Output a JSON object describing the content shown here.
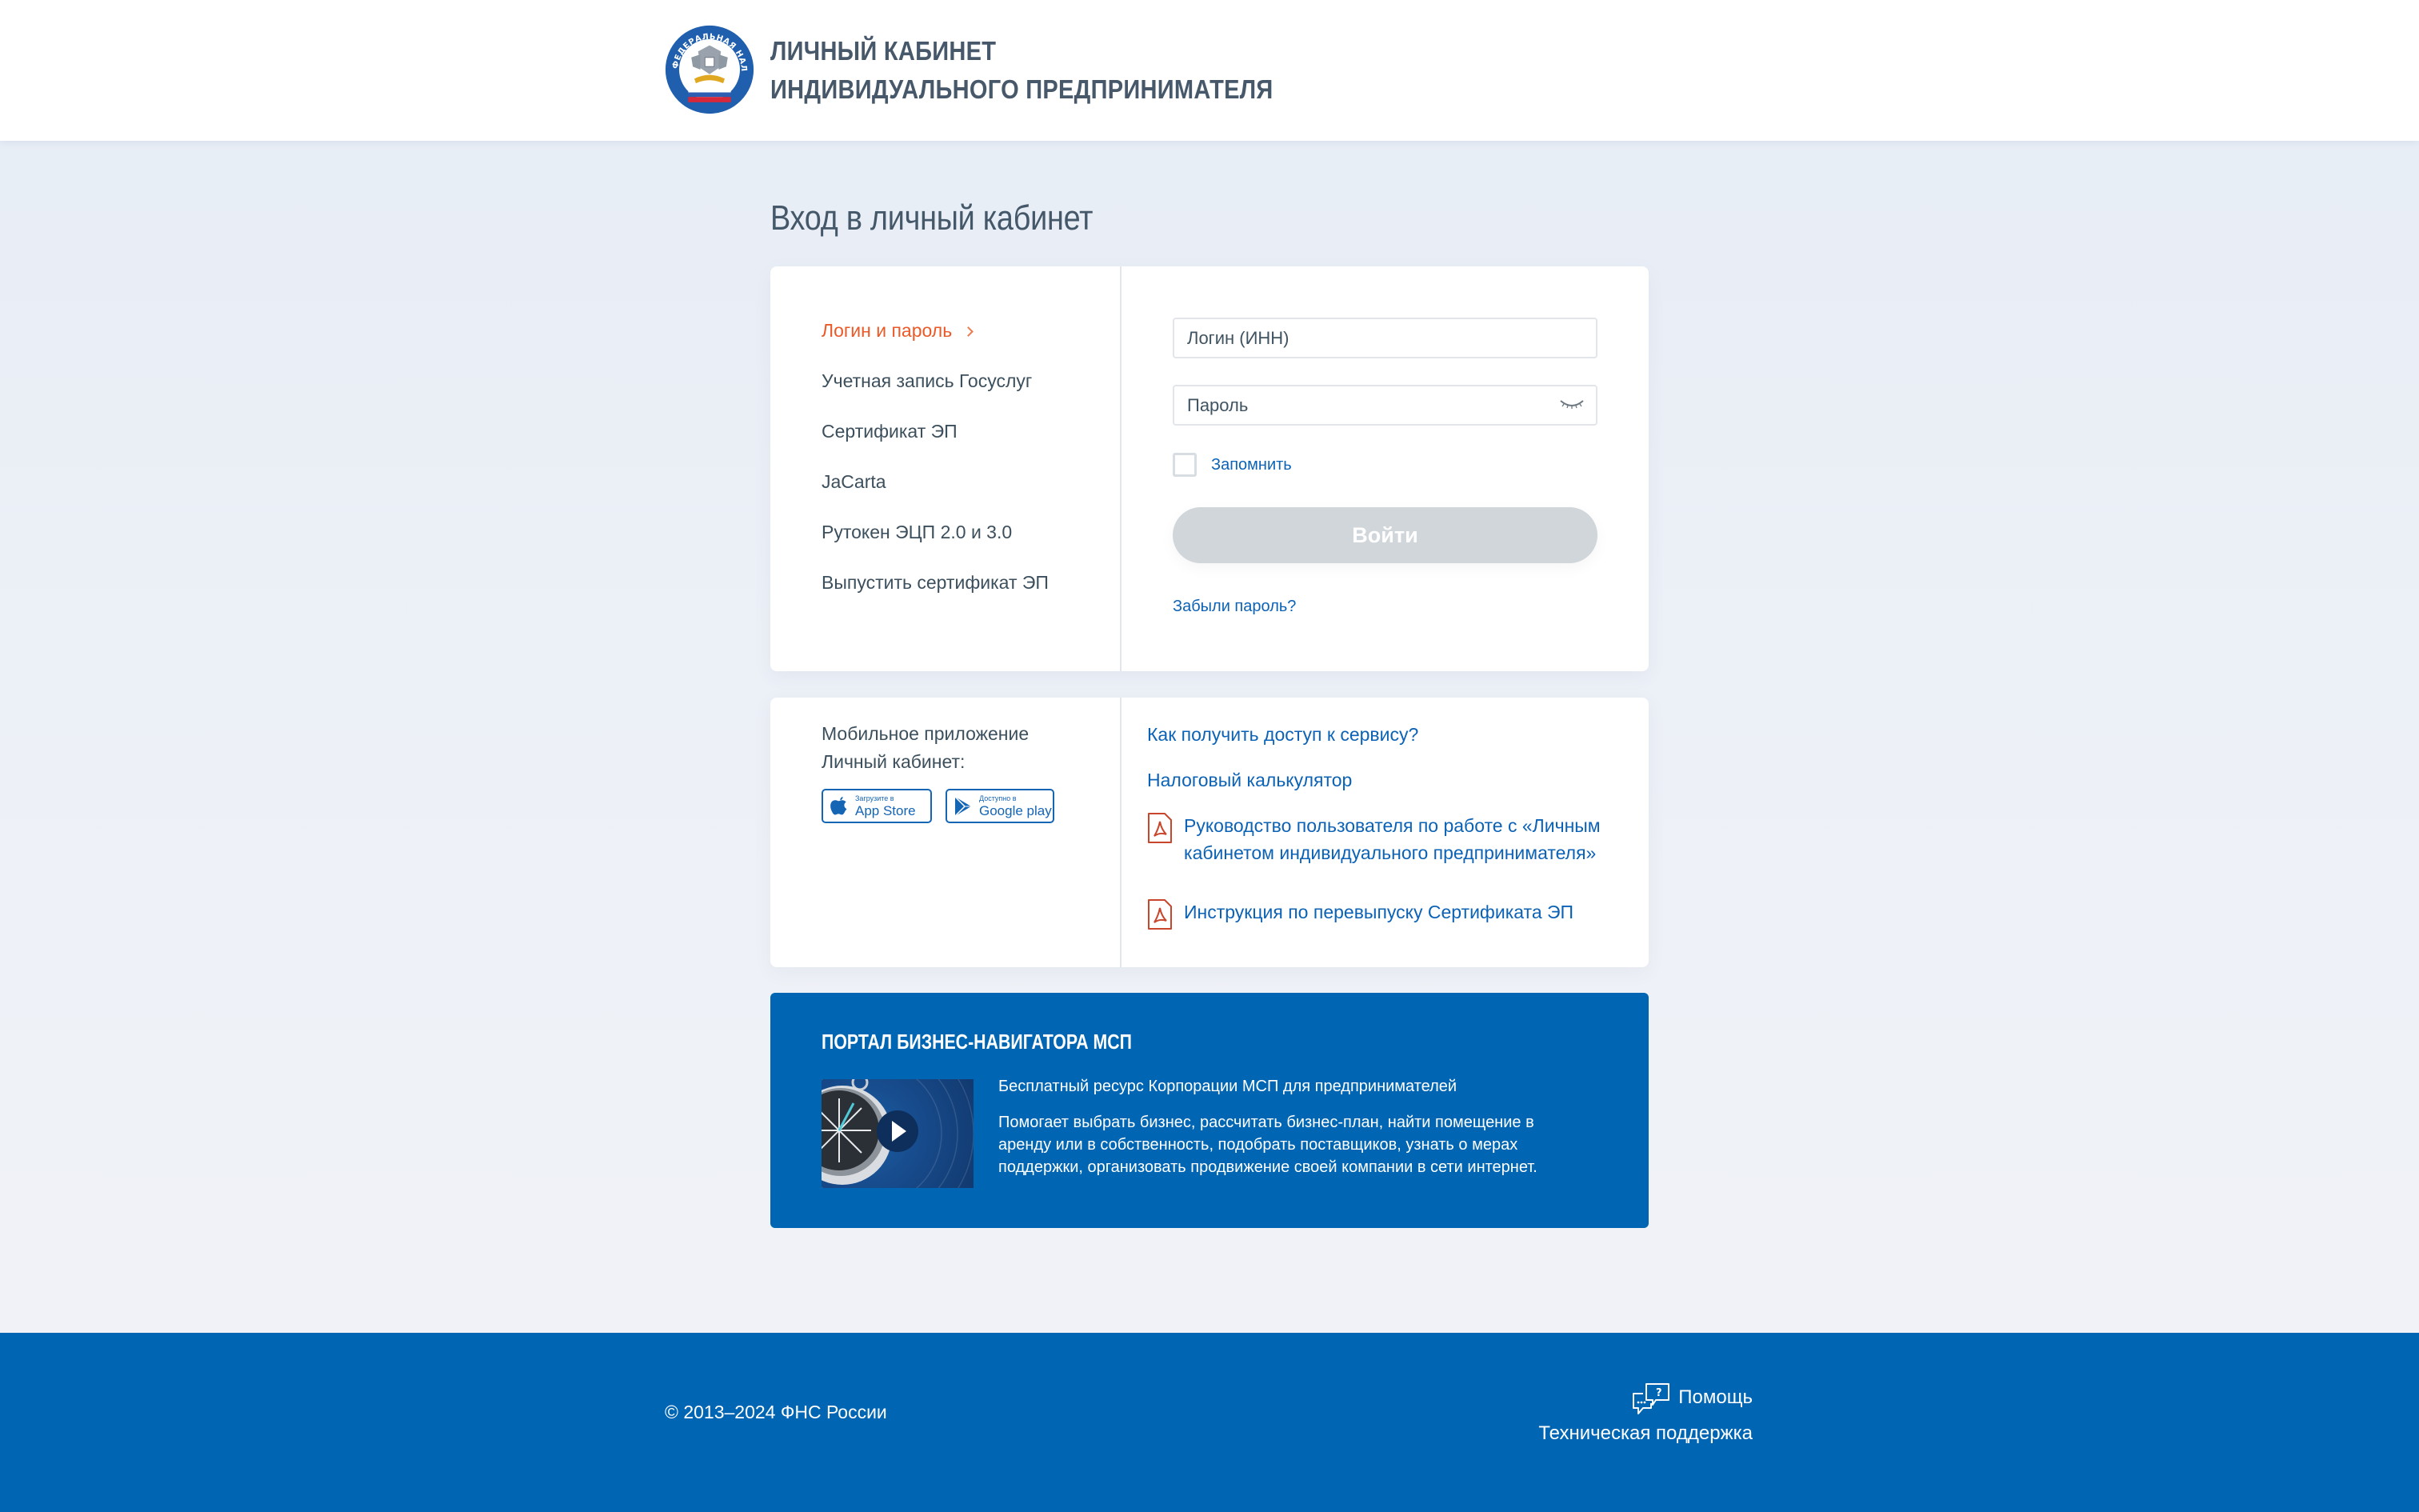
{
  "header": {
    "logo_alt": "ФЕДЕРАЛЬНАЯ НАЛОГОВАЯ СЛУЖБА",
    "title_line1": "ЛИЧНЫЙ КАБИНЕТ",
    "title_line2": "ИНДИВИДУАЛЬНОГО ПРЕДПРИНИМАТЕЛЯ"
  },
  "page": {
    "title": "Вход в личный кабинет"
  },
  "login_methods": [
    {
      "label": "Логин и пароль",
      "active": true
    },
    {
      "label": "Учетная запись Госуслуг",
      "active": false
    },
    {
      "label": "Сертификат ЭП",
      "active": false
    },
    {
      "label": "JaCarta",
      "active": false
    },
    {
      "label": "Рутокен ЭЦП 2.0 и 3.0",
      "active": false
    },
    {
      "label": "Выпустить сертификат ЭП",
      "active": false
    }
  ],
  "form": {
    "login_placeholder": "Логин (ИНН)",
    "login_value": "",
    "password_placeholder": "Пароль",
    "password_value": "",
    "remember_label": "Запомнить",
    "remember_checked": false,
    "submit_label": "Войти",
    "forgot_label": "Забыли пароль?"
  },
  "mobile": {
    "title_line1": "Мобильное приложение",
    "title_line2": "Личный кабинет:",
    "appstore_small": "Загрузите в",
    "appstore_big": "App Store",
    "googleplay_small": "Доступно в",
    "googleplay_big": "Google play"
  },
  "info_links": [
    {
      "label": "Как получить доступ к сервису?",
      "icon": null
    },
    {
      "label": "Налоговый калькулятор",
      "icon": null
    },
    {
      "label_line1": "Руководство пользователя по работе с «Личным",
      "label_line2": "кабинетом индивидуального предпринимателя»",
      "icon": "pdf-icon"
    },
    {
      "label": "Инструкция по перевыпуску Сертификата ЭП",
      "icon": "pdf-icon"
    }
  ],
  "promo": {
    "title": "ПОРТАЛ БИЗНЕС-НАВИГАТОРА МСП",
    "subtitle": "Бесплатный ресурс Корпорации МСП для предпринимателей",
    "description": "Помогает выбрать бизнес, рассчитать бизнес-план, найти помещение в аренду или в собственность, подобрать поставщиков, узнать о мерах поддержки, организовать продвижение своей компании в сети интернет."
  },
  "footer": {
    "copyright": "© 2013–2024 ФНС России",
    "help_label": "Помощь",
    "support_label": "Техническая поддержка"
  },
  "colors": {
    "accent_orange": "#ea5a28",
    "link_blue": "#0c62b5",
    "brand_blue": "#0066b3",
    "button_disabled": "#d1d6db",
    "text_dark": "#3f5361"
  }
}
